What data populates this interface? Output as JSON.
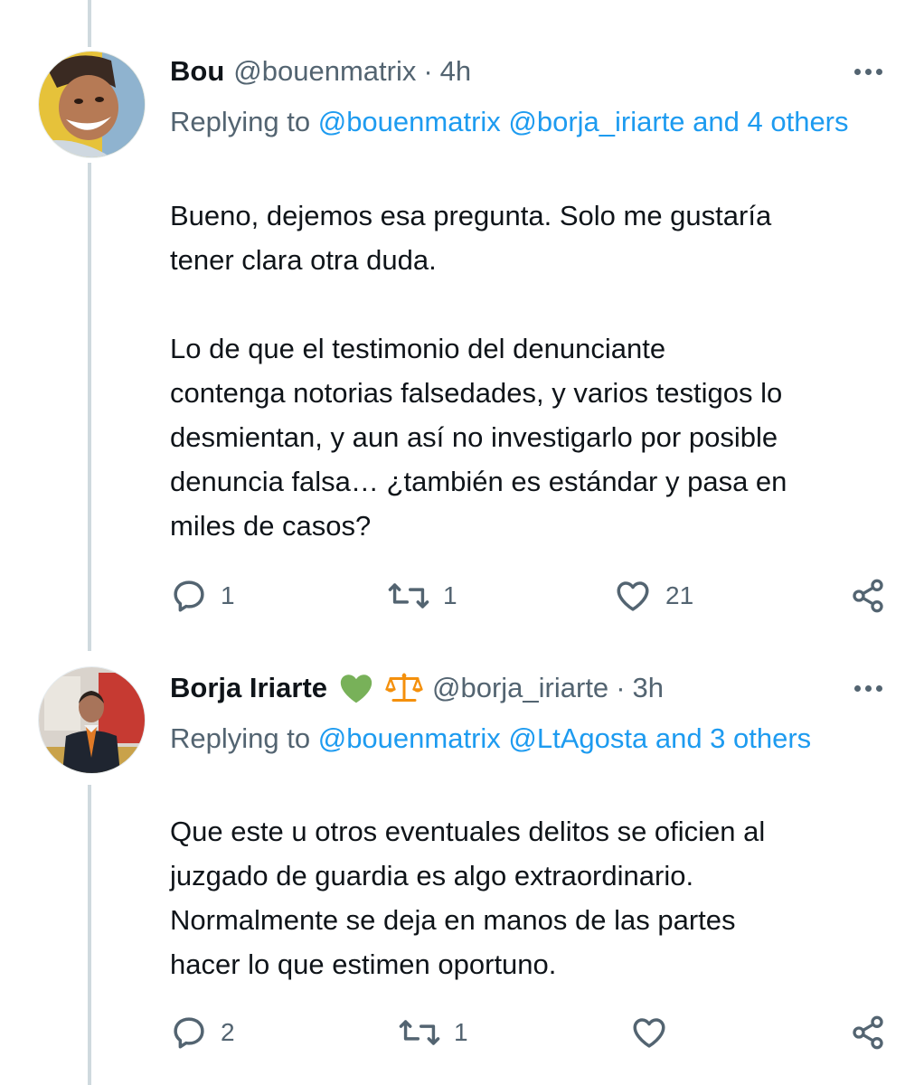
{
  "tweets": [
    {
      "name": "Bou",
      "handle": "@bouenmatrix",
      "dot": "·",
      "time": "4h",
      "replying_prefix": "Replying to ",
      "replying_mentions": "@bouenmatrix @borja_iriarte and 4 others",
      "body": "Bueno, dejemos esa pregunta. Solo me gustaría\ntener clara otra duda.\n\nLo de que el testimonio del denunciante\ncontenga notorias falsedades, y varios testigos lo\ndesmientan, y aun así no investigarlo por posible\ndenuncia falsa… ¿también es estándar y pasa en\nmiles de casos?",
      "replies": "1",
      "retweets": "1",
      "likes": "21"
    },
    {
      "name": "Borja Iriarte",
      "name_emojis": [
        "green-heart-icon",
        "scales-icon"
      ],
      "handle": "@borja_iriarte",
      "dot": "·",
      "time": "3h",
      "replying_prefix": "Replying to ",
      "replying_mentions": "@bouenmatrix @LtAgosta and 3 others",
      "body": "Que este u otros eventuales delitos se oficien al\njuzgado de guardia es algo extraordinario.\nNormalmente se deja en manos de las partes\nhacer lo que estimen oportuno.",
      "replies": "2",
      "retweets": "1",
      "likes": ""
    }
  ],
  "colors": {
    "text": "#0f1419",
    "muted": "#536471",
    "link": "#1d9bf0",
    "thread_line": "#cfd9de",
    "green_heart": "#78b159",
    "scales": "#f4900c"
  }
}
